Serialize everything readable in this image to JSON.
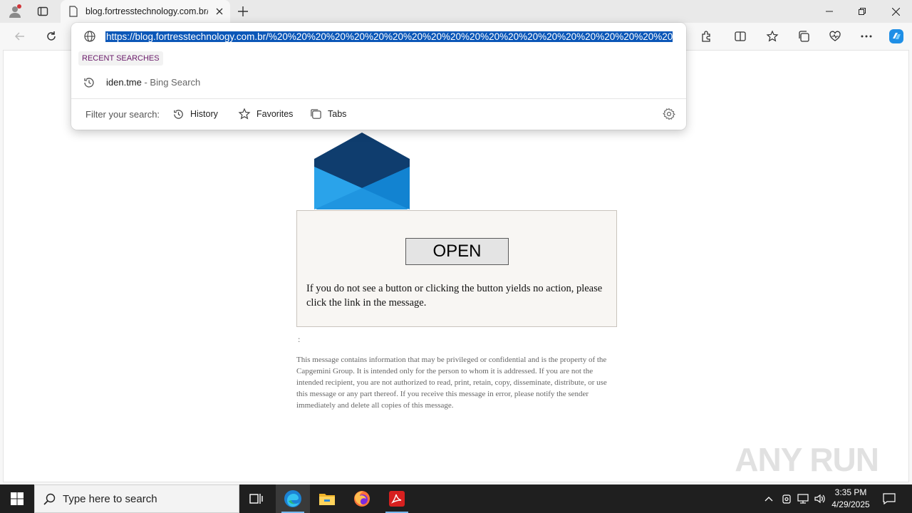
{
  "browser": {
    "tab_title": "blog.fortresstechnology.com.br/",
    "url": "https://blog.fortresstechnology.com.br/%20%20%20%20%20%20%20%20%20%20%20%20%20%20%20%20%20%20%20%20%20%20%20%20%20%20%20%20%20%20%20%20"
  },
  "omnibox": {
    "recent_header": "RECENT SEARCHES",
    "suggestion_main": "iden.tme",
    "suggestion_sub": " - Bing Search",
    "filter_label": "Filter your search:",
    "filters": [
      "History",
      "Favorites",
      "Tabs"
    ]
  },
  "page": {
    "open_button": "OPEN",
    "box_message": "If you do not see a button or clicking the button yields no action, please click the link in the message.",
    "colon": ":",
    "disclaimer": "This message contains information that may be privileged or confidential and is the property of the Capgemini Group. It is intended only for the person to whom it is addressed. If you are not the intended recipient, you are not authorized to read, print, retain, copy, disseminate, distribute, or use this message or any part thereof. If you receive this message in error, please notify the sender immediately and delete all copies of this message.",
    "watermark": "ANY RUN"
  },
  "taskbar": {
    "search_placeholder": "Type here to search",
    "time": "3:35 PM",
    "date": "4/29/2025"
  },
  "colors": {
    "selection": "#0b57b8",
    "envelope_dark": "#0f3d6e",
    "envelope_light": "#1f95e0",
    "taskbar": "#1f1f1f"
  }
}
